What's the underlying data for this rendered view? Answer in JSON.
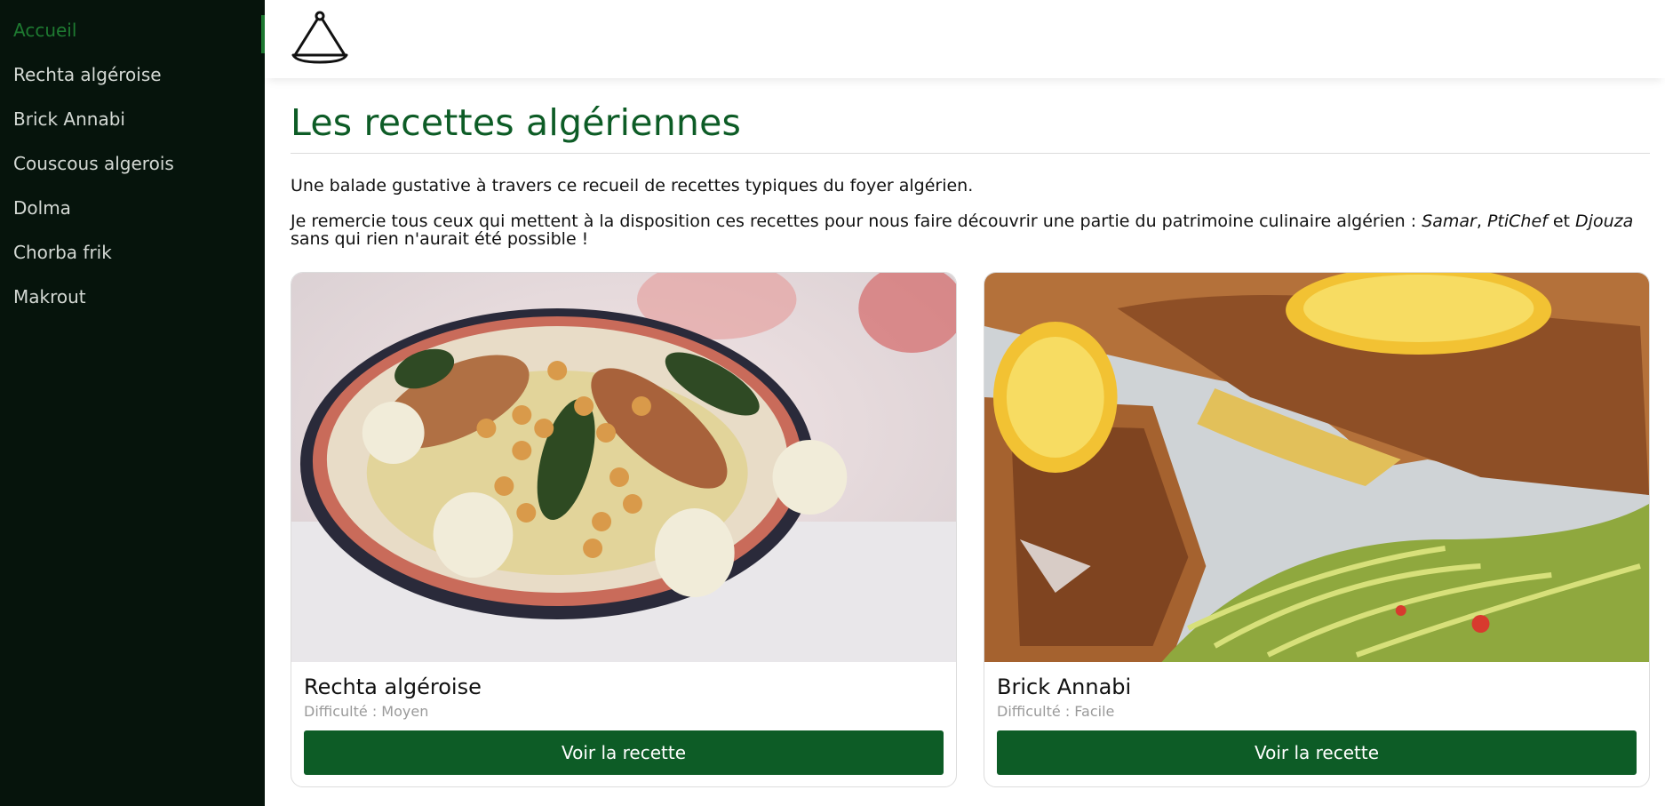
{
  "sidebar": {
    "items": [
      {
        "label": "Accueil",
        "active": true
      },
      {
        "label": "Rechta algéroise"
      },
      {
        "label": "Brick Annabi"
      },
      {
        "label": "Couscous algerois"
      },
      {
        "label": "Dolma"
      },
      {
        "label": "Chorba frik"
      },
      {
        "label": "Makrout"
      }
    ],
    "background": "#06140c",
    "active_color": "#1e7a31"
  },
  "header": {
    "logo_icon": "tajine-icon"
  },
  "main": {
    "title": "Les recettes algériennes",
    "intro_1": "Une balade gustative à travers ce recueil de recettes typiques du foyer algérien.",
    "intro_2_start": "Je remercie tous ceux qui mettent à la disposition ces recettes pour nous faire découvrir une partie du patrimoine culinaire algérien : ",
    "credit_1": "Samar",
    "sep_1": ", ",
    "credit_2": "PtiChef",
    "sep_2": " et ",
    "credit_3": "Djouza",
    "intro_2_end": " sans qui rien n'aurait été possible !"
  },
  "cards": [
    {
      "title": "Rechta algéroise",
      "difficulty_label": "Difficulté",
      "difficulty": "Moyen",
      "button": "Voir la recette",
      "image_icon": "rechta-dish-photo"
    },
    {
      "title": "Brick Annabi",
      "difficulty_label": "Difficulté",
      "difficulty": "Facile",
      "button": "Voir la recette",
      "image_icon": "brick-dish-photo"
    }
  ],
  "colors": {
    "brand_green": "#0d5c26",
    "title_green": "#0d5c26"
  }
}
